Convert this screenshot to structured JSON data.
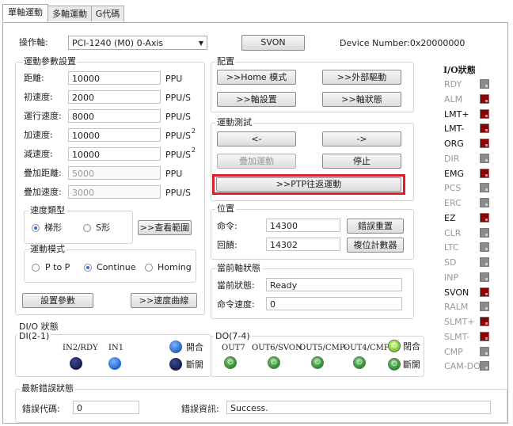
{
  "tabs": [
    {
      "label": "單軸運動"
    },
    {
      "label": "多軸運動"
    },
    {
      "label": "G代碼"
    }
  ],
  "header": {
    "axis_label": "操作軸:",
    "axis_value": "PCI-1240 (M0) 0-Axis",
    "svon_button": "SVON",
    "device_number": "Device Number:0x20000000"
  },
  "motion_params": {
    "title": "運動參數設置",
    "rows": [
      {
        "label": "距離:",
        "value": "10000",
        "unit": "PPU",
        "sup": ""
      },
      {
        "label": "初速度:",
        "value": "2000",
        "unit": "PPU/S",
        "sup": ""
      },
      {
        "label": "運行速度:",
        "value": "8000",
        "unit": "PPU/S",
        "sup": ""
      },
      {
        "label": "加速度:",
        "value": "10000",
        "unit": "PPU/S",
        "sup": "2"
      },
      {
        "label": "減速度:",
        "value": "10000",
        "unit": "PPU/S",
        "sup": "2"
      },
      {
        "label": "疊加距離:",
        "value": "5000",
        "unit": "PPU",
        "sup": ""
      },
      {
        "label": "疊加速度:",
        "value": "3000",
        "unit": "PPU/S",
        "sup": ""
      }
    ],
    "speed_type": {
      "title": "速度類型",
      "options": [
        "梯形",
        "S形"
      ],
      "selected": 0,
      "range_button": ">>查看範圍"
    },
    "motion_mode": {
      "title": "運動模式",
      "options": [
        "P to P",
        "Continue",
        "Homing"
      ],
      "selected": 1
    },
    "set_button": "設置參數",
    "curve_button": ">>速度曲線"
  },
  "config": {
    "title": "配置",
    "buttons": [
      ">>Home 模式",
      ">>外部驅動",
      ">>軸設置",
      ">>軸狀態"
    ]
  },
  "motion_test": {
    "title": "運動測試",
    "left_button": "<-",
    "right_button": "->",
    "overlay_button": "疊加運動",
    "stop_button": "停止",
    "ptp_button": ">>PTP往返運動"
  },
  "position": {
    "title": "位置",
    "command_label": "命令:",
    "command_value": "14300",
    "feedback_label": "回饋:",
    "feedback_value": "14302",
    "error_reset_button": "錯誤重置",
    "counter_reset_button": "複位計數器"
  },
  "axis_state": {
    "title": "當前軸狀態",
    "state_label": "當前狀態:",
    "state_value": "Ready",
    "cmd_speed_label": "命令速度:",
    "cmd_speed_value": "0"
  },
  "io_status": {
    "title": "I/O狀態",
    "items": [
      {
        "label": "RDY",
        "active": false,
        "color": "#8c8c8c"
      },
      {
        "label": "ALM",
        "active": false,
        "color": "#8b0000"
      },
      {
        "label": "LMT+",
        "active": true,
        "color": "#8b0000"
      },
      {
        "label": "LMT-",
        "active": true,
        "color": "#8b0000"
      },
      {
        "label": "ORG",
        "active": true,
        "color": "#8b0000"
      },
      {
        "label": "DIR",
        "active": false,
        "color": "#8c8c8c"
      },
      {
        "label": "EMG",
        "active": true,
        "color": "#8b0000"
      },
      {
        "label": "PCS",
        "active": false,
        "color": "#8c8c8c"
      },
      {
        "label": "ERC",
        "active": false,
        "color": "#8c8c8c"
      },
      {
        "label": "EZ",
        "active": true,
        "color": "#8b0000"
      },
      {
        "label": "CLR",
        "active": false,
        "color": "#8c8c8c"
      },
      {
        "label": "LTC",
        "active": false,
        "color": "#8c8c8c"
      },
      {
        "label": "SD",
        "active": false,
        "color": "#8c8c8c"
      },
      {
        "label": "INP",
        "active": false,
        "color": "#8c8c8c"
      },
      {
        "label": "SVON",
        "active": true,
        "color": "#8b0000"
      },
      {
        "label": "RALM",
        "active": false,
        "color": "#8c8c8c"
      },
      {
        "label": "SLMT+",
        "active": false,
        "color": "#8b0000"
      },
      {
        "label": "SLMT-",
        "active": false,
        "color": "#8b0000"
      },
      {
        "label": "CMP",
        "active": false,
        "color": "#8c8c8c"
      },
      {
        "label": "CAM-DO",
        "active": false,
        "color": "#8c8c8c"
      }
    ]
  },
  "dio": {
    "title": "DI/O 狀態",
    "di_title": "DI(2-1)",
    "di_labels": [
      "IN2/RDY",
      "IN1"
    ],
    "di_legend_on": "開合",
    "di_legend_off": "斷開",
    "do_title": "DO(7-4)",
    "do_labels": [
      "OUT7",
      "OUT6/SVON",
      "OUT5/CMP-",
      "OUT4/CMP+"
    ],
    "do_legend_on": "閉合",
    "do_legend_off": "斷開"
  },
  "error_status": {
    "title": "最新錯誤狀態",
    "code_label": "錯誤代碼:",
    "code_value": "0",
    "info_label": "錯誤資訊:",
    "info_value": "Success."
  }
}
